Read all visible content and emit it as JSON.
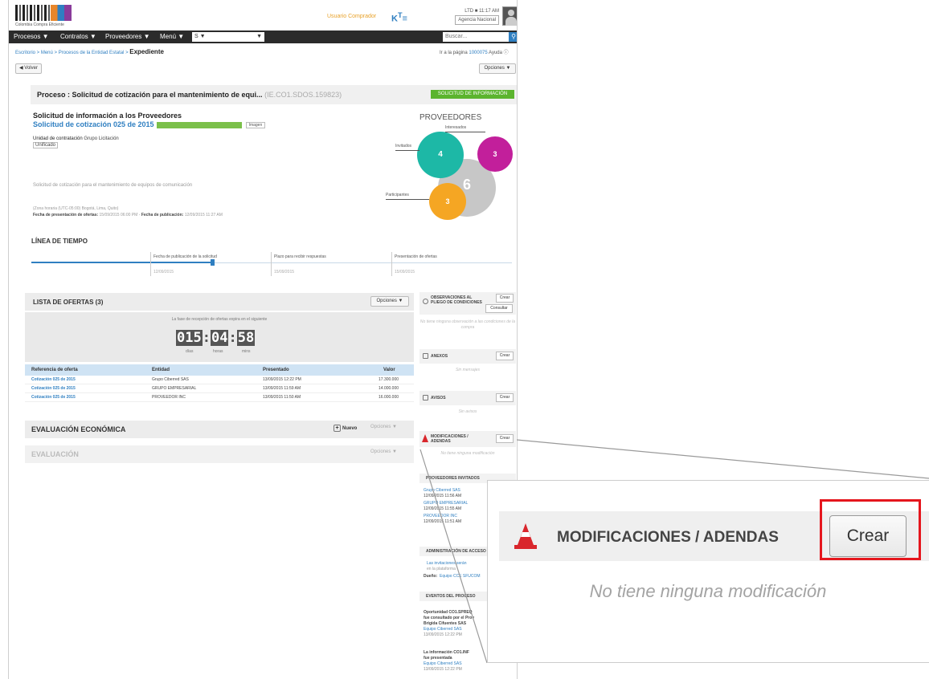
{
  "header": {
    "logo_caption": "Colombia Compra Eficiente",
    "link_text": "Usuario Comprador",
    "user_line1": "LTD ■ 11:17 AM",
    "user_line2": "Agencia Nacional"
  },
  "nav": {
    "items": [
      "Procesos ▼",
      "Contratos ▼",
      "Proveedores ▼",
      "Menú ▼"
    ],
    "select_value": "S ▼",
    "search_placeholder": "Buscar..."
  },
  "breadcrumb": {
    "path": "Escritorio > Menú > Procesos de la Entidad Estatal > ",
    "current": "Expediente"
  },
  "toplinks": {
    "text": "Ir a la página ",
    "link": "1000075",
    "help": " Ayuda ⓘ"
  },
  "buttons": {
    "back": "◀ Volver",
    "options": "Opciones ▼"
  },
  "process": {
    "title": "Proceso : Solicitud de cotización para el mantenimiento de equi...",
    "code": "(IE.CO1.SDOS.159823)",
    "status": "SOLICITUD DE INFORMACIÓN"
  },
  "solicitud": {
    "title": "Solicitud de información a los Proveedores",
    "subtitle": "Solicitud de cotización 025 de 2015",
    "tag": "Imagen",
    "unit_label": "Unidad de contratación",
    "unit_value": "Grupo Licitación",
    "unit_badge": "Unificado",
    "description": "Solicitud de cotización para el mantenimiento de equipos de comunicación",
    "dates_line1": "(Zona horaria (UTC-05:00) Bogotá, Lima, Quito)",
    "dates_label1": "Fecha de presentación de ofertas:",
    "dates_value1": "15/09/2015 06:00 PM",
    "dates_label2": "Fecha de publicación:",
    "dates_value2": "12/09/2015 11:27 AM"
  },
  "providers": {
    "title": "PROVEEDORES",
    "label_top": "Interesados",
    "label_left": "Invitados",
    "label_bottom": "Participantes",
    "teal_count": "4",
    "magenta_count": "3",
    "grey_count": "6",
    "orange_count": "3",
    "colors": {
      "teal": "#1db8a6",
      "magenta": "#c21f9b",
      "grey": "#c7c7c7",
      "orange": "#f5a623"
    }
  },
  "timeline": {
    "title": "LÍNEA DE TIEMPO",
    "steps": [
      {
        "label": "Fecha de publicación de la solicitud",
        "value": "12/09/2015"
      },
      {
        "label": "Plazo para recibir respuestas",
        "value": "15/09/2015"
      },
      {
        "label": "Presentación de ofertas",
        "value": "15/09/2015"
      }
    ],
    "progress_fraction": 0.38
  },
  "offers": {
    "title": "LISTA DE OFERTAS (3)",
    "options_label": "Opciones ▼",
    "timer_note": "La fase de recepción de ofertas expira en el siguiente",
    "timer_days": "015",
    "timer_hours": "04",
    "timer_minutes": "58",
    "unit_days": "días",
    "unit_hours": "horas",
    "unit_minutes": "mins",
    "columns": [
      "Referencia de oferta",
      "Entidad",
      "Presentado",
      "Valor"
    ],
    "rows": [
      {
        "ref": "Cotización 025 de 2015",
        "entity": "Grupo Ciberred SAS",
        "date": "13/09/2015 12:22 PM",
        "value": "17.300.000"
      },
      {
        "ref": "Cotización 025 de 2015",
        "entity": "GRUPO EMPRESARIAL",
        "date": "13/09/2015 11:59 AM",
        "value": "14.000.000"
      },
      {
        "ref": "Cotización 025 de 2015",
        "entity": "PROVEEDOR INC",
        "date": "13/09/2015 11:50 AM",
        "value": "16.000.000"
      }
    ]
  },
  "evaluation": {
    "title": "EVALUACIÓN ECONÓMICA",
    "new_label": "Nuevo",
    "options_label": "Opciones ▼",
    "title2": "EVALUACIÓN",
    "options2_label": "Opciones ▼"
  },
  "sidebar": {
    "obs_title": "OBSERVACIONES AL PLIEGO DE CONDICIONES",
    "obs_btn": "Crear",
    "obs_btn2": "Consultar",
    "obs_empty": "No tiene ninguna observación a las condiciones de la compra",
    "anexos_title": "ANEXOS",
    "anexos_btn": "Crear",
    "anexos_empty": "Sin mensajes",
    "avisos_title": "AVISOS",
    "avisos_btn": "Crear",
    "avisos_empty": "Sin avisos",
    "mod_title": "MODIFICACIONES / ADENDAS",
    "mod_btn": "Crear",
    "mod_empty": "No tiene ninguna modificación",
    "prov_title": "PROVEEDORES INVITADOS",
    "prov_items": [
      {
        "name": "Grupo Ciberred SAS",
        "date": "12/09/2015 11:56 AM"
      },
      {
        "name": "GRUPO EMPRESARIAL",
        "date": "12/09/2015 11:55 AM"
      },
      {
        "name": "PROVEEDOR INC",
        "date": "12/09/2015 11:51 AM"
      }
    ],
    "admin_title": "ADMINISTRACIÓN DE ACCESO",
    "admin_note": "Las invitaciones serán",
    "admin_note2": "en la plataforma",
    "admin_owner_label": "Dueño:",
    "admin_owner": "Equipo CCE SFUCOM",
    "events_title": "EVENTOS DEL PROCESO",
    "ev1_title": "Oportunidad CO1.SPREQ",
    "ev1_line2": "fue consultado por el Prov",
    "ev1_line3": "Brigida Cifuentes SAS",
    "ev1_link": "Equipo Ciberred SAS",
    "ev1_date": "13/09/2015 12:22 PM",
    "ev2_title": "La información CO1.INF",
    "ev2_line2": "fue presentada",
    "ev2_link": "Equipo Ciberred SAS",
    "ev2_date": "13/09/2015 12:22 PM"
  },
  "zoom": {
    "title": "MODIFICACIONES / ADENDAS",
    "button": "Crear",
    "empty": "No tiene ninguna modificación",
    "highlight_color": "#e5161d"
  }
}
